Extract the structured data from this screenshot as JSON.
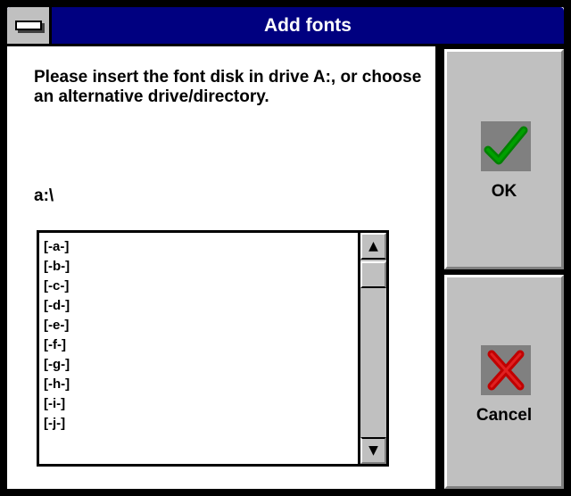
{
  "window": {
    "title": "Add fonts"
  },
  "dialog": {
    "message": "Please insert the font disk in drive A:, or choose an alternative drive/directory.",
    "path": "a:\\"
  },
  "listbox": {
    "items": [
      "[-a-]",
      "[-b-]",
      "[-c-]",
      "[-d-]",
      "[-e-]",
      "[-f-]",
      "[-g-]",
      "[-h-]",
      "[-i-]",
      "[-j-]"
    ],
    "scroll_up_glyph": "▲",
    "scroll_down_glyph": "▼"
  },
  "buttons": {
    "ok_label": "OK",
    "cancel_label": "Cancel"
  },
  "colors": {
    "titlebar": "#000080",
    "button_face": "#c0c0c0",
    "ok_check": "#008000",
    "cancel_x": "#c00000"
  }
}
